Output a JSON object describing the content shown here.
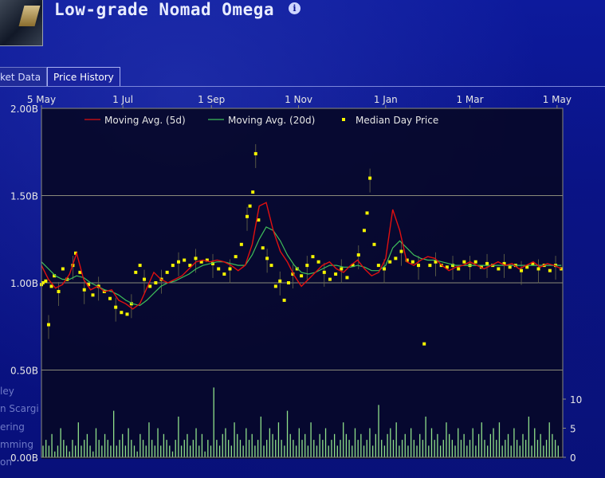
{
  "window": {
    "title": "Low-grade Nomad Omega"
  },
  "tabs": [
    {
      "label": "ket Data",
      "active": false
    },
    {
      "label": "Price History",
      "active": true
    }
  ],
  "background_labels": [
    "ley",
    "n Scargi",
    "ering",
    "mming",
    "on"
  ],
  "colors": {
    "ma5": "#e01010",
    "ma20": "#3fbf5a",
    "median": "#f5f500",
    "volume": "#8fe08a",
    "grid": "#8a8a7a"
  },
  "chart_data": {
    "type": "line",
    "x_tick_labels": [
      "5 May",
      "1 Jul",
      "1 Sep",
      "1 Nov",
      "1 Jan",
      "1 Mar",
      "1 May"
    ],
    "y_tick_labels": [
      "2.00B",
      "1.50B",
      "1.00B",
      "0.50B",
      "0.00B"
    ],
    "ylim": [
      0,
      2000000000
    ],
    "volume_tick_labels": [
      "10",
      "5",
      "0"
    ],
    "volume_ylim": [
      0,
      10
    ],
    "legend_position": "top",
    "grid": true,
    "series": [
      {
        "name": "Moving Avg.  (5d)",
        "style": "line"
      },
      {
        "name": "Moving Avg.  (20d)",
        "style": "line"
      },
      {
        "name": "Median Day Price",
        "style": "points"
      }
    ],
    "median_price_points": [
      {
        "day": 0,
        "price": 0.99
      },
      {
        "day": 1,
        "price": 1.0
      },
      {
        "day": 3,
        "price": 1.01
      },
      {
        "day": 5,
        "price": 0.76
      },
      {
        "day": 7,
        "price": 0.98
      },
      {
        "day": 9,
        "price": 1.04
      },
      {
        "day": 12,
        "price": 0.95
      },
      {
        "day": 15,
        "price": 1.08
      },
      {
        "day": 18,
        "price": 1.02
      },
      {
        "day": 22,
        "price": 1.1
      },
      {
        "day": 24,
        "price": 1.17
      },
      {
        "day": 27,
        "price": 1.06
      },
      {
        "day": 30,
        "price": 0.96
      },
      {
        "day": 33,
        "price": 0.99
      },
      {
        "day": 36,
        "price": 0.93
      },
      {
        "day": 40,
        "price": 0.98
      },
      {
        "day": 44,
        "price": 0.95
      },
      {
        "day": 48,
        "price": 0.91
      },
      {
        "day": 52,
        "price": 0.86
      },
      {
        "day": 56,
        "price": 0.83
      },
      {
        "day": 60,
        "price": 0.82
      },
      {
        "day": 63,
        "price": 0.88
      },
      {
        "day": 66,
        "price": 1.06
      },
      {
        "day": 69,
        "price": 1.1
      },
      {
        "day": 72,
        "price": 1.02
      },
      {
        "day": 76,
        "price": 0.98
      },
      {
        "day": 80,
        "price": 1.0
      },
      {
        "day": 84,
        "price": 1.02
      },
      {
        "day": 88,
        "price": 1.06
      },
      {
        "day": 92,
        "price": 1.1
      },
      {
        "day": 96,
        "price": 1.12
      },
      {
        "day": 100,
        "price": 1.13
      },
      {
        "day": 104,
        "price": 1.1
      },
      {
        "day": 108,
        "price": 1.14
      },
      {
        "day": 112,
        "price": 1.12
      },
      {
        "day": 116,
        "price": 1.13
      },
      {
        "day": 120,
        "price": 1.11
      },
      {
        "day": 124,
        "price": 1.08
      },
      {
        "day": 128,
        "price": 1.05
      },
      {
        "day": 132,
        "price": 1.08
      },
      {
        "day": 136,
        "price": 1.15
      },
      {
        "day": 140,
        "price": 1.22
      },
      {
        "day": 144,
        "price": 1.38
      },
      {
        "day": 146,
        "price": 1.44
      },
      {
        "day": 148,
        "price": 1.52
      },
      {
        "day": 150,
        "price": 1.74
      },
      {
        "day": 152,
        "price": 1.36
      },
      {
        "day": 155,
        "price": 1.2
      },
      {
        "day": 158,
        "price": 1.14
      },
      {
        "day": 161,
        "price": 1.1
      },
      {
        "day": 164,
        "price": 0.98
      },
      {
        "day": 167,
        "price": 1.01
      },
      {
        "day": 170,
        "price": 0.9
      },
      {
        "day": 173,
        "price": 1.0
      },
      {
        "day": 176,
        "price": 1.05
      },
      {
        "day": 179,
        "price": 1.08
      },
      {
        "day": 182,
        "price": 1.04
      },
      {
        "day": 186,
        "price": 1.1
      },
      {
        "day": 190,
        "price": 1.15
      },
      {
        "day": 194,
        "price": 1.12
      },
      {
        "day": 198,
        "price": 1.06
      },
      {
        "day": 202,
        "price": 1.02
      },
      {
        "day": 206,
        "price": 1.05
      },
      {
        "day": 210,
        "price": 1.08
      },
      {
        "day": 214,
        "price": 1.03
      },
      {
        "day": 218,
        "price": 1.1
      },
      {
        "day": 222,
        "price": 1.16
      },
      {
        "day": 226,
        "price": 1.3
      },
      {
        "day": 228,
        "price": 1.4
      },
      {
        "day": 230,
        "price": 1.6
      },
      {
        "day": 233,
        "price": 1.22
      },
      {
        "day": 236,
        "price": 1.1
      },
      {
        "day": 240,
        "price": 1.08
      },
      {
        "day": 244,
        "price": 1.12
      },
      {
        "day": 248,
        "price": 1.14
      },
      {
        "day": 252,
        "price": 1.18
      },
      {
        "day": 256,
        "price": 1.13
      },
      {
        "day": 260,
        "price": 1.12
      },
      {
        "day": 264,
        "price": 1.1
      },
      {
        "day": 268,
        "price": 0.65
      },
      {
        "day": 272,
        "price": 1.1
      },
      {
        "day": 276,
        "price": 1.12
      },
      {
        "day": 280,
        "price": 1.1
      },
      {
        "day": 284,
        "price": 1.09
      },
      {
        "day": 288,
        "price": 1.1
      },
      {
        "day": 292,
        "price": 1.08
      },
      {
        "day": 296,
        "price": 1.12
      },
      {
        "day": 300,
        "price": 1.1
      },
      {
        "day": 304,
        "price": 1.12
      },
      {
        "day": 308,
        "price": 1.09
      },
      {
        "day": 312,
        "price": 1.11
      },
      {
        "day": 316,
        "price": 1.1
      },
      {
        "day": 320,
        "price": 1.08
      },
      {
        "day": 324,
        "price": 1.11
      },
      {
        "day": 328,
        "price": 1.09
      },
      {
        "day": 332,
        "price": 1.1
      },
      {
        "day": 336,
        "price": 1.07
      },
      {
        "day": 340,
        "price": 1.09
      },
      {
        "day": 344,
        "price": 1.11
      },
      {
        "day": 348,
        "price": 1.08
      },
      {
        "day": 352,
        "price": 1.1
      },
      {
        "day": 356,
        "price": 1.07
      },
      {
        "day": 360,
        "price": 1.1
      },
      {
        "day": 364,
        "price": 1.08
      }
    ],
    "ma5_values": [
      1.1,
      1.02,
      0.97,
      0.99,
      1.05,
      1.17,
      1.02,
      0.96,
      0.98,
      0.95,
      0.96,
      0.9,
      0.88,
      0.85,
      0.88,
      0.97,
      1.06,
      1.02,
      1.0,
      1.02,
      1.04,
      1.08,
      1.12,
      1.13,
      1.12,
      1.13,
      1.12,
      1.1,
      1.07,
      1.1,
      1.22,
      1.44,
      1.46,
      1.3,
      1.18,
      1.12,
      1.04,
      0.98,
      1.02,
      1.06,
      1.1,
      1.12,
      1.08,
      1.06,
      1.1,
      1.13,
      1.08,
      1.04,
      1.06,
      1.14,
      1.42,
      1.3,
      1.12,
      1.1,
      1.13,
      1.15,
      1.14,
      1.1,
      1.07,
      1.09,
      1.1,
      1.12,
      1.1,
      1.08,
      1.1,
      1.12,
      1.1,
      1.11,
      1.08,
      1.1,
      1.12,
      1.09,
      1.11,
      1.1,
      1.08
    ],
    "ma20_values": [
      1.12,
      1.08,
      1.04,
      1.02,
      1.02,
      1.04,
      1.03,
      1.0,
      0.98,
      0.96,
      0.95,
      0.93,
      0.9,
      0.88,
      0.87,
      0.9,
      0.94,
      0.98,
      1.0,
      1.01,
      1.03,
      1.05,
      1.08,
      1.1,
      1.11,
      1.12,
      1.12,
      1.11,
      1.1,
      1.1,
      1.16,
      1.25,
      1.32,
      1.3,
      1.24,
      1.16,
      1.1,
      1.06,
      1.05,
      1.06,
      1.08,
      1.1,
      1.1,
      1.09,
      1.09,
      1.1,
      1.09,
      1.07,
      1.07,
      1.1,
      1.2,
      1.24,
      1.2,
      1.16,
      1.14,
      1.13,
      1.13,
      1.12,
      1.11,
      1.1,
      1.1,
      1.1,
      1.1,
      1.1,
      1.1,
      1.1,
      1.1,
      1.1,
      1.1,
      1.1,
      1.1,
      1.1,
      1.1,
      1.1,
      1.1
    ],
    "volume_values": [
      2,
      3,
      2,
      4,
      1,
      2,
      5,
      3,
      2,
      1,
      3,
      2,
      6,
      2,
      3,
      4,
      2,
      1,
      5,
      3,
      2,
      4,
      3,
      2,
      8,
      2,
      3,
      4,
      2,
      5,
      3,
      2,
      1,
      4,
      3,
      2,
      6,
      3,
      2,
      5,
      2,
      4,
      3,
      2,
      1,
      3,
      7,
      2,
      3,
      4,
      2,
      3,
      5,
      2,
      4,
      1,
      3,
      2,
      12,
      3,
      2,
      4,
      5,
      3,
      2,
      6,
      4,
      3,
      2,
      5,
      3,
      4,
      2,
      3,
      7,
      2,
      3,
      5,
      4,
      3,
      6,
      3,
      2,
      8,
      4,
      3,
      2,
      5,
      3,
      4,
      2,
      6,
      3,
      2,
      4,
      3,
      5,
      2,
      3,
      4,
      2,
      3,
      6,
      4,
      3,
      2,
      5,
      3,
      4,
      2,
      3,
      5,
      2,
      4,
      9,
      3,
      2,
      4,
      5,
      3,
      6,
      2,
      3,
      4,
      2,
      5,
      3,
      2,
      4,
      3,
      7,
      2,
      5,
      3,
      4,
      2,
      3,
      6,
      4,
      3,
      2,
      5,
      3,
      4,
      2,
      3,
      5,
      2,
      4,
      6,
      3,
      2,
      4,
      5,
      3,
      6,
      2,
      3,
      4,
      2,
      5,
      3,
      2,
      4,
      3,
      7,
      2,
      5,
      3,
      4,
      2,
      3,
      6,
      4,
      3,
      2
    ]
  }
}
